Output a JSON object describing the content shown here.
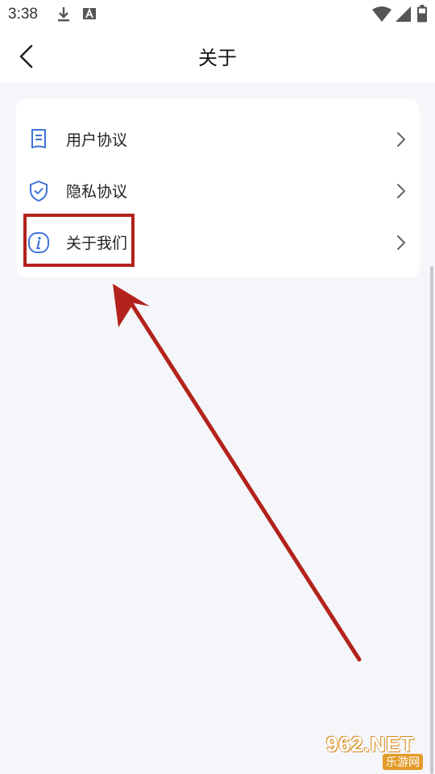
{
  "status_bar": {
    "time": "3:38",
    "icons": [
      "download-icon",
      "a-icon",
      "wifi-icon",
      "signal-icon",
      "battery-icon"
    ]
  },
  "header": {
    "title": "关于",
    "back_icon": "chevron-left-icon"
  },
  "menu": {
    "items": [
      {
        "label": "用户协议",
        "icon": "document-icon"
      },
      {
        "label": "隐私协议",
        "icon": "shield-check-icon"
      },
      {
        "label": "关于我们",
        "icon": "info-icon"
      }
    ]
  },
  "watermark": {
    "brand": "962.NET",
    "site": "乐游网"
  },
  "colors": {
    "background": "#f5f6f9",
    "icon_blue": "#3f74d6",
    "annotation_red": "#b3221c"
  }
}
